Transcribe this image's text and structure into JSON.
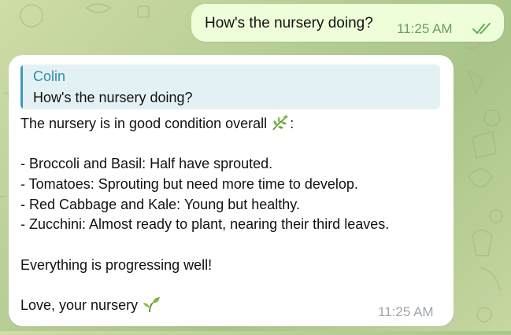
{
  "outgoing": {
    "text": "How's the nursery doing?",
    "time": "11:25 AM",
    "status_icon": "double-check-icon"
  },
  "incoming": {
    "reply": {
      "author": "Colin",
      "text": "How's the nursery doing?"
    },
    "lines": {
      "l1": "The nursery is in good condition overall",
      "l1_suffix": ":",
      "l1_emoji": "herb-icon",
      "l3": "- Broccoli and Basil: Half have sprouted.",
      "l4": "- Tomatoes: Sprouting but need more time to develop.",
      "l5": "- Red Cabbage and Kale: Young but healthy.",
      "l6": "- Zucchini: Almost ready to plant, nearing their third leaves.",
      "l8": "Everything is progressing well!",
      "l10": "Love, your nursery",
      "l10_emoji": "seedling-icon"
    },
    "time": "11:25 AM"
  },
  "colors": {
    "outgoing_bubble": "#eefed8",
    "incoming_bubble": "#ffffff",
    "reply_accent": "#3a9bbf",
    "check_color": "#5fae5a"
  }
}
